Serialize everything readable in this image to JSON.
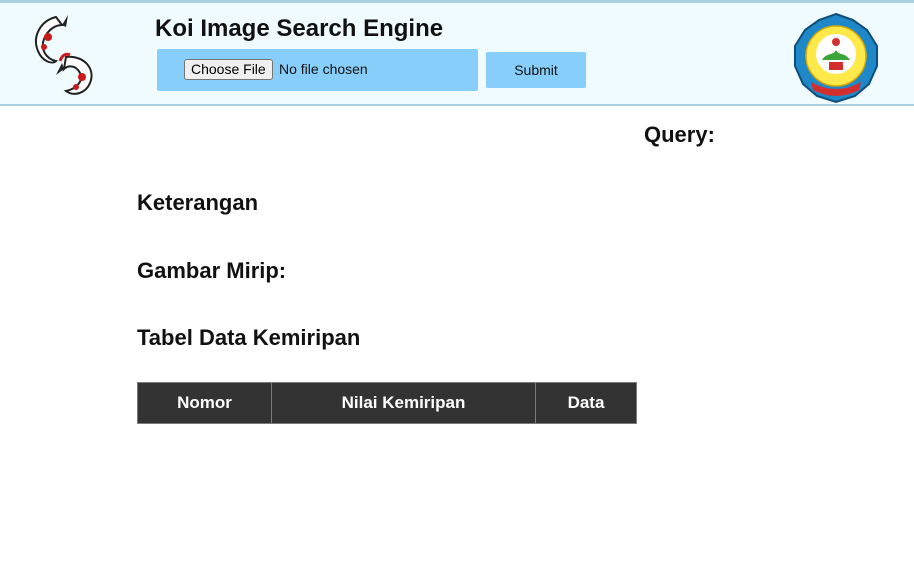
{
  "header": {
    "title": "Koi Image Search Engine",
    "left_logo": "koi-fish-logo",
    "right_logo": "university-emblem",
    "upload": {
      "choose_label": "Choose File",
      "status": "No file chosen"
    },
    "submit_label": "Submit"
  },
  "main": {
    "query_label": "Query:",
    "keterangan_label": "Keterangan",
    "gambar_mirip_label": "Gambar Mirip:",
    "tabel_label": "Tabel Data Kemiripan",
    "table": {
      "headers": [
        "Nomor",
        "Nilai Kemiripan",
        "Data"
      ]
    }
  },
  "colors": {
    "header_bg": "#f0fbff",
    "accent": "#87cefa",
    "table_header_bg": "#333333"
  }
}
